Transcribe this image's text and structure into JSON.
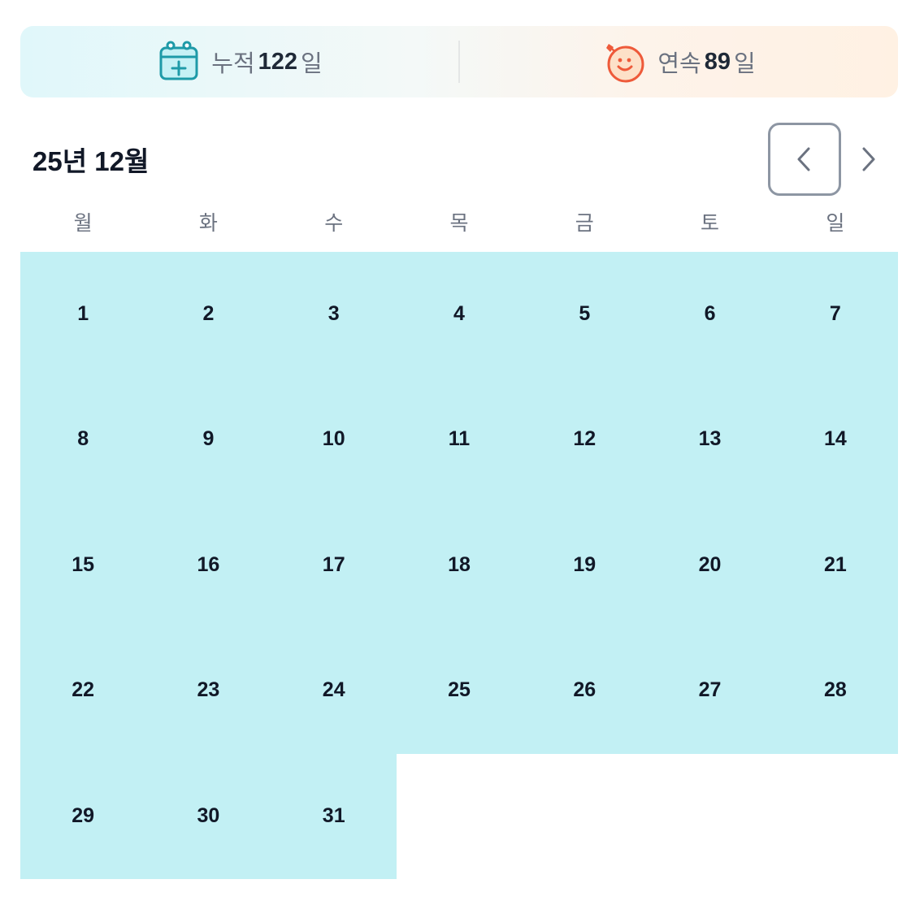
{
  "stats": {
    "total": {
      "label": "누적",
      "value": "122",
      "unit": "일",
      "icon": "calendar-plus-icon"
    },
    "streak": {
      "label": "연속",
      "value": "89",
      "unit": "일",
      "icon": "smiling-face-icon"
    }
  },
  "calendar": {
    "title": "25년 12월",
    "prev_icon": "chevron-left-icon",
    "next_icon": "chevron-right-icon",
    "weekdays": [
      "월",
      "화",
      "수",
      "목",
      "금",
      "토",
      "일"
    ],
    "days": [
      "1",
      "2",
      "3",
      "4",
      "5",
      "6",
      "7",
      "8",
      "9",
      "10",
      "11",
      "12",
      "13",
      "14",
      "15",
      "16",
      "17",
      "18",
      "19",
      "20",
      "21",
      "22",
      "23",
      "24",
      "25",
      "26",
      "27",
      "28",
      "29",
      "30",
      "31"
    ],
    "filled_color": "#c2f0f4"
  },
  "colors": {
    "accent_teal": "#1e9aa8",
    "accent_orange": "#ee5a3a"
  }
}
